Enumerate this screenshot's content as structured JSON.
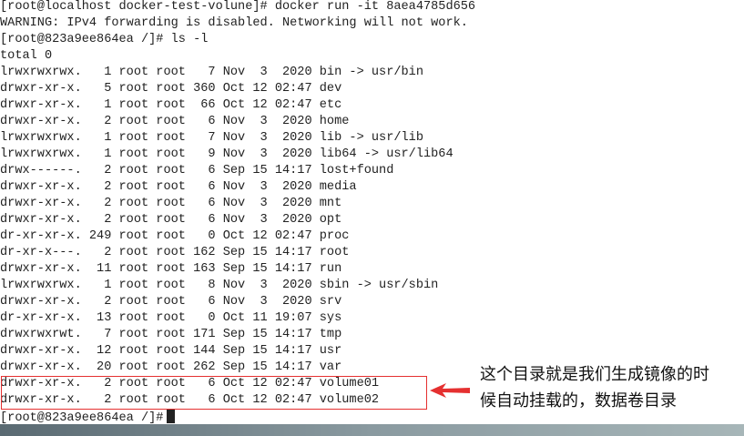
{
  "terminal": {
    "lines": [
      "[root@localhost docker-test-volune]# docker run -it 8aea4785d656",
      "WARNING: IPv4 forwarding is disabled. Networking will not work.",
      "[root@823a9ee864ea /]# ls -l",
      "total 0",
      "lrwxrwxrwx.   1 root root   7 Nov  3  2020 bin -> usr/bin",
      "drwxr-xr-x.   5 root root 360 Oct 12 02:47 dev",
      "drwxr-xr-x.   1 root root  66 Oct 12 02:47 etc",
      "drwxr-xr-x.   2 root root   6 Nov  3  2020 home",
      "lrwxrwxrwx.   1 root root   7 Nov  3  2020 lib -> usr/lib",
      "lrwxrwxrwx.   1 root root   9 Nov  3  2020 lib64 -> usr/lib64",
      "drwx------.   2 root root   6 Sep 15 14:17 lost+found",
      "drwxr-xr-x.   2 root root   6 Nov  3  2020 media",
      "drwxr-xr-x.   2 root root   6 Nov  3  2020 mnt",
      "drwxr-xr-x.   2 root root   6 Nov  3  2020 opt",
      "dr-xr-xr-x. 249 root root   0 Oct 12 02:47 proc",
      "dr-xr-x---.   2 root root 162 Sep 15 14:17 root",
      "drwxr-xr-x.  11 root root 163 Sep 15 14:17 run",
      "lrwxrwxrwx.   1 root root   8 Nov  3  2020 sbin -> usr/sbin",
      "drwxr-xr-x.   2 root root   6 Nov  3  2020 srv",
      "dr-xr-xr-x.  13 root root   0 Oct 11 19:07 sys",
      "drwxrwxrwt.   7 root root 171 Sep 15 14:17 tmp",
      "drwxr-xr-x.  12 root root 144 Sep 15 14:17 usr",
      "drwxr-xr-x.  20 root root 262 Sep 15 14:17 var",
      "drwxr-xr-x.   2 root root   6 Oct 12 02:47 volume01",
      "drwxr-xr-x.   2 root root   6 Oct 12 02:47 volume02"
    ],
    "prompt": "[root@823a9ee864ea /]#"
  },
  "annotation": {
    "line1": "这个目录就是我们生成镜像的时",
    "line2": "候自动挂载的，数据卷目录",
    "color": "#e53030"
  }
}
